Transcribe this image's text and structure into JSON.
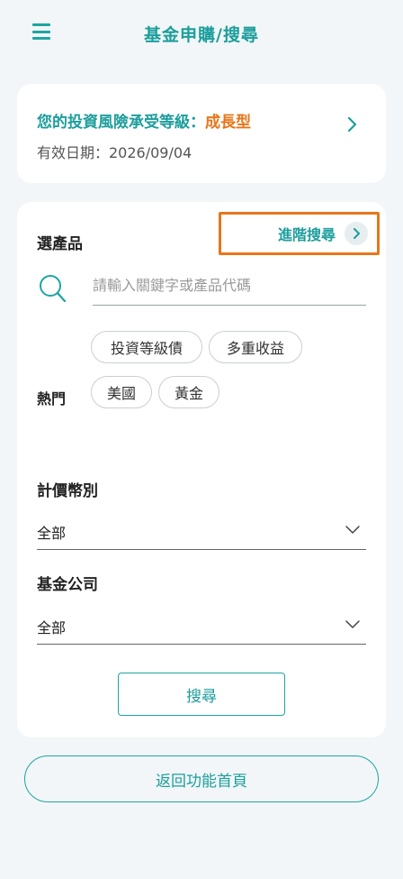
{
  "header": {
    "title": "基金申購/搜尋",
    "menu_icon": "menu-icon"
  },
  "risk_card": {
    "label_prefix": "您的投資風險承受等級：",
    "level": "成長型",
    "valid_date": "有效日期：2026/09/04"
  },
  "search": {
    "section_title": "選產品",
    "advanced_label": "進階搜尋",
    "placeholder": "請輸入關鍵字或產品代碼",
    "hot_label": "熱門",
    "hot_tags": [
      "投資等級債",
      "多重收益",
      "美國",
      "黃金"
    ]
  },
  "filters": {
    "currency_label": "計價幣別",
    "currency_value": "全部",
    "company_label": "基金公司",
    "company_value": "全部"
  },
  "buttons": {
    "search": "搜尋",
    "back": "返回功能首頁"
  },
  "colors": {
    "accent": "#1ca5a2",
    "highlight": "#e8761a",
    "background": "#f2f6f8"
  }
}
